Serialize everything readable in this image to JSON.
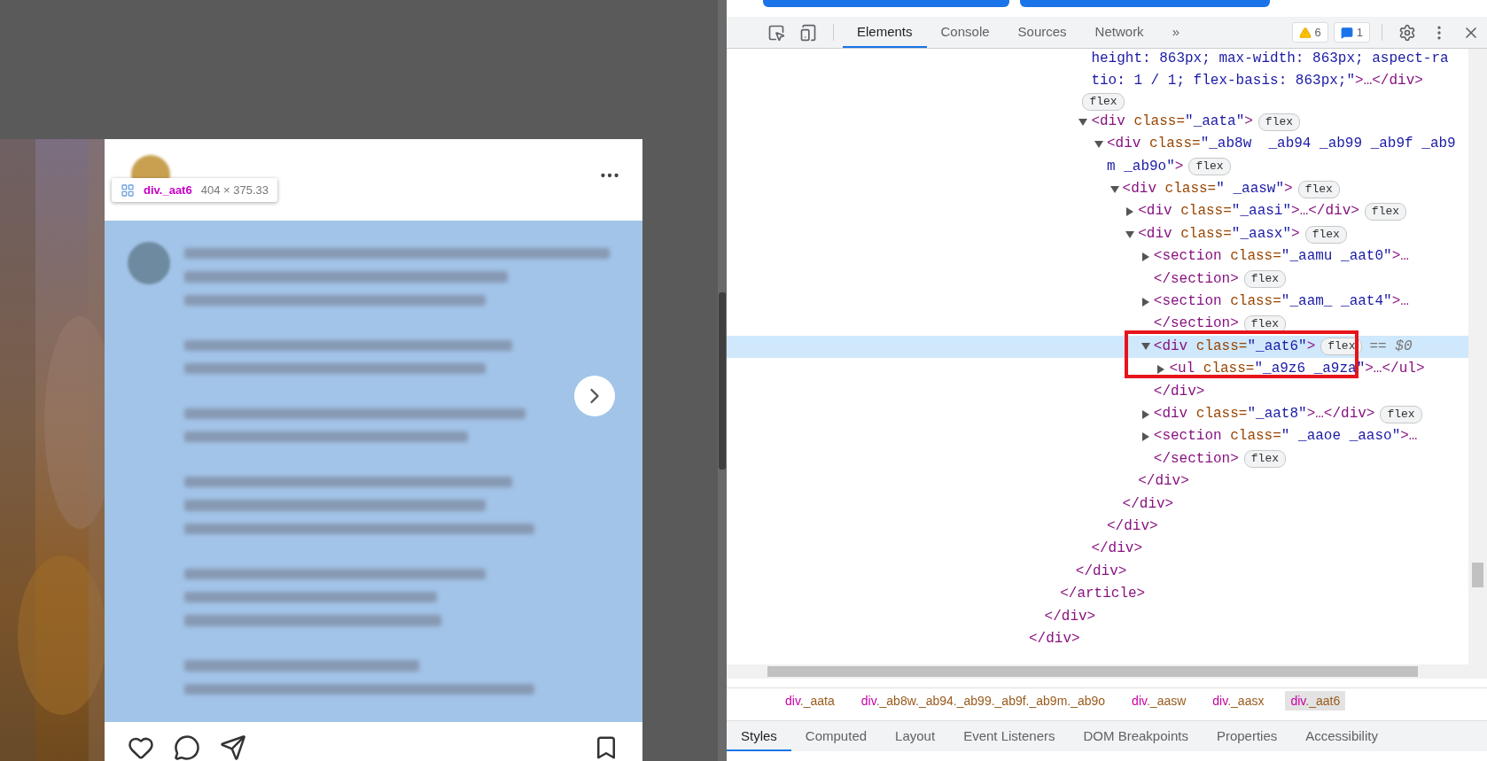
{
  "viewport": {
    "tooltip": {
      "selector": "div._aat6",
      "size": "404 × 375.33"
    }
  },
  "devtools": {
    "tabs": [
      {
        "label": "Elements",
        "selected": true
      },
      {
        "label": "Console",
        "selected": false
      },
      {
        "label": "Sources",
        "selected": false
      },
      {
        "label": "Network",
        "selected": false
      }
    ],
    "more_tabs": "»",
    "counters": [
      {
        "kind": "warning",
        "count": "6"
      },
      {
        "kind": "message",
        "count": "1"
      }
    ],
    "dom_tree": [
      {
        "selected": false,
        "close": "</div>",
        "children": [
          {
            "selected": false,
            "close": "</div>",
            "children": [
              {
                "selected": false,
                "close": "</article>",
                "children": [
                  {
                    "selected": false,
                    "close": "</div>",
                    "children": [
                      {
                        "selected": false,
                        "in_value": true,
                        "open": [
                          "height: 863px; max-width: 863px; aspect-ra",
                          "tio: 1 / 1; flex-basis: 863px;\">…</div>"
                        ],
                        "badge": "flex"
                      },
                      {
                        "selected": false,
                        "open": [
                          "<div class=\"_aata\">"
                        ],
                        "badge": "flex",
                        "expanded": true,
                        "close": "</div>",
                        "children": [
                          {
                            "selected": false,
                            "open": [
                              "<div class=\"_ab8w  _ab94 _ab99 _ab9f _ab9",
                              "m _ab9o\">"
                            ],
                            "badge": "flex",
                            "expanded": true,
                            "close": "</div>",
                            "children": [
                              {
                                "selected": false,
                                "open": [
                                  "<div class=\" _aasw\">"
                                ],
                                "badge": "flex",
                                "expanded": true,
                                "close": "</div>",
                                "children": [
                                  {
                                    "selected": false,
                                    "open": [
                                      "<div class=\"_aasi\">…</div>"
                                    ],
                                    "badge": "flex",
                                    "expanded": false
                                  },
                                  {
                                    "selected": false,
                                    "open": [
                                      "<div class=\"_aasx\">"
                                    ],
                                    "badge": "flex",
                                    "expanded": true,
                                    "close": "</div>",
                                    "children": [
                                      {
                                        "selected": false,
                                        "open": [
                                          "<section class=\"_aamu _aat0\">…"
                                        ],
                                        "expanded": false,
                                        "close": "</section>",
                                        "close_badge": "flex"
                                      },
                                      {
                                        "selected": false,
                                        "open": [
                                          "<section class=\"_aam_ _aat4\">…"
                                        ],
                                        "expanded": false,
                                        "close": "</section>",
                                        "close_badge": "flex"
                                      },
                                      {
                                        "selected": true,
                                        "annotated": true,
                                        "open": [
                                          "<div class=\"_aat6\">"
                                        ],
                                        "badge": "flex",
                                        "console_ref": "== $0",
                                        "expanded": true,
                                        "close": "</div>",
                                        "children": [
                                          {
                                            "selected": false,
                                            "open": [
                                              "<ul class=\"_a9z6 _a9za\">…</ul>"
                                            ],
                                            "expanded": false
                                          }
                                        ]
                                      },
                                      {
                                        "selected": false,
                                        "open": [
                                          "<div class=\"_aat8\">…</div>"
                                        ],
                                        "badge": "flex",
                                        "expanded": false
                                      },
                                      {
                                        "selected": false,
                                        "open": [
                                          "<section class=\" _aaoe _aaso\">…"
                                        ],
                                        "expanded": false,
                                        "close": "</section>",
                                        "close_badge": "flex"
                                      }
                                    ]
                                  }
                                ]
                              }
                            ]
                          }
                        ]
                      }
                    ]
                  }
                ]
              }
            ]
          }
        ]
      }
    ],
    "breadcrumbs": [
      {
        "label": "div._aata",
        "selected": false
      },
      {
        "label": "div._ab8w._ab94._ab99._ab9f._ab9m._ab9o",
        "selected": false
      },
      {
        "label": "div._aasw",
        "selected": false
      },
      {
        "label": "div._aasx",
        "selected": false
      },
      {
        "label": "div._aat6",
        "selected": true
      }
    ],
    "panel_tabs": [
      {
        "label": "Styles",
        "selected": true
      },
      {
        "label": "Computed",
        "selected": false
      },
      {
        "label": "Layout",
        "selected": false
      },
      {
        "label": "Event Listeners",
        "selected": false
      },
      {
        "label": "DOM Breakpoints",
        "selected": false
      },
      {
        "label": "Properties",
        "selected": false
      },
      {
        "label": "Accessibility",
        "selected": false
      }
    ]
  }
}
